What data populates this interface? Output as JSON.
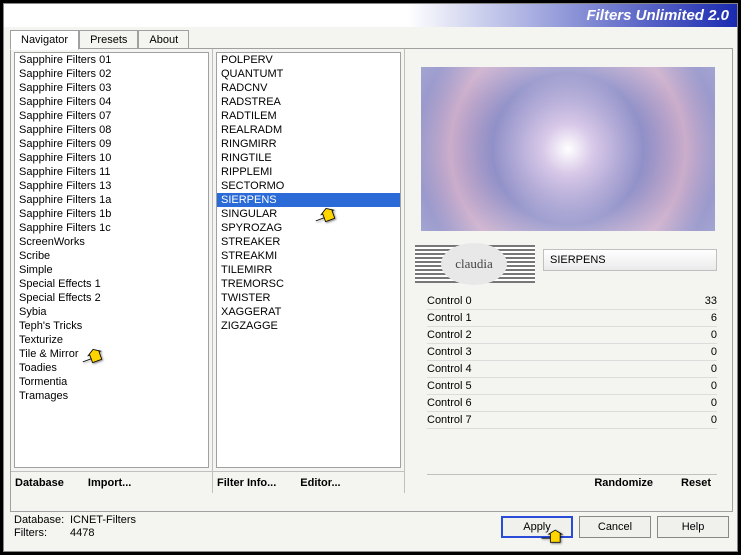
{
  "window_title": "Filters Unlimited 2.0",
  "tabs": {
    "navigator": "Navigator",
    "presets": "Presets",
    "about": "About"
  },
  "cat_list": [
    "Sapphire Filters 01",
    "Sapphire Filters 02",
    "Sapphire Filters 03",
    "Sapphire Filters 04",
    "Sapphire Filters 07",
    "Sapphire Filters 08",
    "Sapphire Filters 09",
    "Sapphire Filters 10",
    "Sapphire Filters 11",
    "Sapphire Filters 13",
    "Sapphire Filters 1a",
    "Sapphire Filters 1b",
    "Sapphire Filters 1c",
    "ScreenWorks",
    "Scribe",
    "Simple",
    "Special Effects 1",
    "Special Effects 2",
    "Sybia",
    "Teph's Tricks",
    "Texturize",
    "Tile & Mirror",
    "Toadies",
    "Tormentia",
    "Tramages"
  ],
  "filter_list": [
    "POLPERV",
    "QUANTUMT",
    "RADCNV",
    "RADSTREA",
    "RADTILEM",
    "REALRADM",
    "RINGMIRR",
    "RINGTILE",
    "RIPPLEMI",
    "SECTORMO",
    "SIERPENS",
    "SINGULAR",
    "SPYROZAG",
    "STREAKER",
    "STREAKMI",
    "TILEMIRR",
    "TREMORSC",
    "TWISTER",
    "XAGGERAT",
    "ZIGZAGGE"
  ],
  "selected_filter_index": 10,
  "selected_filter_name": "SIERPENS",
  "footer1": {
    "database": "Database",
    "import": "Import..."
  },
  "footer2": {
    "info": "Filter Info...",
    "editor": "Editor..."
  },
  "right_footer": {
    "randomize": "Randomize",
    "reset": "Reset"
  },
  "controls": [
    {
      "label": "Control 0",
      "value": "33"
    },
    {
      "label": "Control 1",
      "value": "6"
    },
    {
      "label": "Control 2",
      "value": "0"
    },
    {
      "label": "Control 3",
      "value": "0"
    },
    {
      "label": "Control 4",
      "value": "0"
    },
    {
      "label": "Control 5",
      "value": "0"
    },
    {
      "label": "Control 6",
      "value": "0"
    },
    {
      "label": "Control 7",
      "value": "0"
    }
  ],
  "status": {
    "db_label": "Database:",
    "db_value": "ICNET-Filters",
    "filters_label": "Filters:",
    "filters_value": "4478"
  },
  "buttons": {
    "apply": "Apply",
    "cancel": "Cancel",
    "help": "Help"
  },
  "stamp": "claudia"
}
